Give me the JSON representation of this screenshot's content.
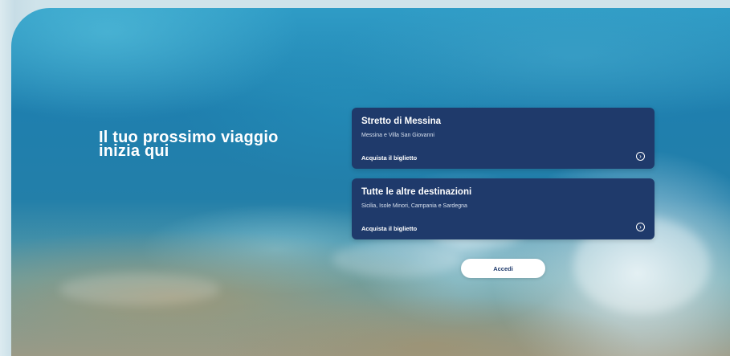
{
  "hero": {
    "headline": "Il tuo prossimo viaggio inizia qui"
  },
  "cards": [
    {
      "title": "Stretto di Messina",
      "subtitle": "Messina e Villa San Giovanni",
      "cta": "Acquista il biglietto",
      "icon": "chevron-right-circle-icon"
    },
    {
      "title": "Tutte le altre destinazioni",
      "subtitle": "Sicilia, Isole Minori, Campania e Sardegna",
      "cta": "Acquista il biglietto",
      "icon": "chevron-right-circle-icon"
    }
  ],
  "login": {
    "label": "Accedi"
  },
  "colors": {
    "card_bg": "#1f3a6b",
    "button_bg": "#ffffff",
    "text_light": "#ffffff"
  }
}
